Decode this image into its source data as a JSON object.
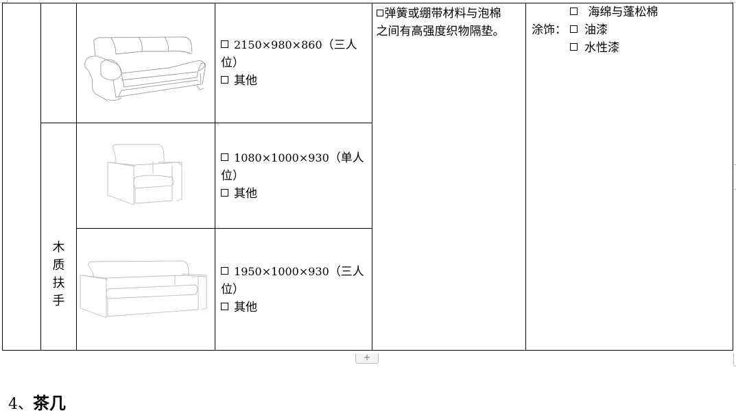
{
  "table": {
    "rows": [
      {
        "group_label": "",
        "image": "sofa-three-seat-leather-armrest",
        "size": "2150×980×860",
        "size_suffix": "（三人",
        "size_suffix2": "位）",
        "other": "其他"
      },
      {
        "group_label": "木质扶手",
        "image": "armchair-single-seat-wood-armrest",
        "size": "1080×1000×930",
        "size_suffix": "（单人",
        "size_suffix2": "位）",
        "other": "其他"
      },
      {
        "group_label": "",
        "image": "sofa-three-seat-wood-armrest",
        "size": "1950×1000×930",
        "size_suffix": "（三人",
        "size_suffix2": "位）",
        "other": "其他"
      }
    ],
    "group_label_chars": [
      "木",
      "质",
      "扶",
      "手"
    ],
    "material_text": "弹簧或绷带材料与泡棉之间有高强度织物隔垫。",
    "material_line1": "弹簧或绷带材料与泡棉",
    "material_line2": "之间有高强度织物隔垫。",
    "finish": {
      "top_option": "海绵与蓬松棉",
      "label": "涂饰：",
      "options": [
        "油漆",
        "水性漆"
      ]
    }
  },
  "controls": {
    "add_row": "+"
  },
  "section_heading": {
    "number": "4、",
    "title": "茶几"
  }
}
